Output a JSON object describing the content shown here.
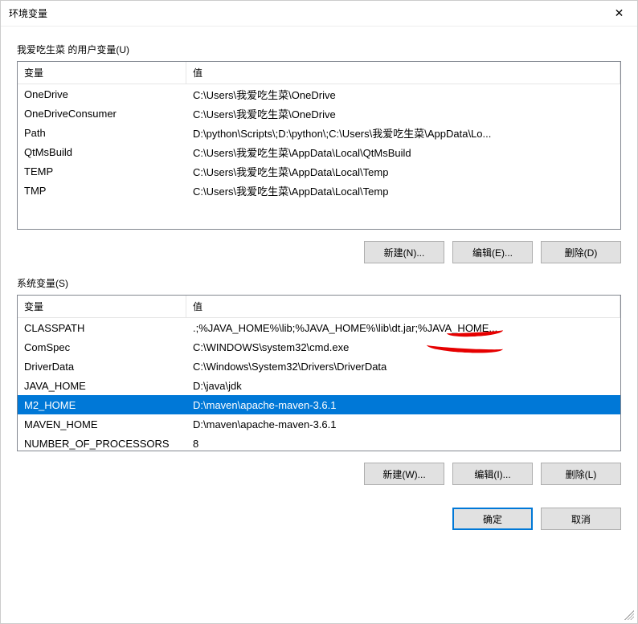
{
  "title": "环境变量",
  "user_section_label": "我爱吃生菜 的用户变量(U)",
  "system_section_label": "系统变量(S)",
  "columns": {
    "variable": "变量",
    "value": "值"
  },
  "user_vars": [
    {
      "name": "OneDrive",
      "value": "C:\\Users\\我爱吃生菜\\OneDrive"
    },
    {
      "name": "OneDriveConsumer",
      "value": "C:\\Users\\我爱吃生菜\\OneDrive"
    },
    {
      "name": "Path",
      "value": "D:\\python\\Scripts\\;D:\\python\\;C:\\Users\\我爱吃生菜\\AppData\\Lo..."
    },
    {
      "name": "QtMsBuild",
      "value": "C:\\Users\\我爱吃生菜\\AppData\\Local\\QtMsBuild"
    },
    {
      "name": "TEMP",
      "value": "C:\\Users\\我爱吃生菜\\AppData\\Local\\Temp"
    },
    {
      "name": "TMP",
      "value": "C:\\Users\\我爱吃生菜\\AppData\\Local\\Temp"
    }
  ],
  "system_vars": [
    {
      "name": "CLASSPATH",
      "value": ".;%JAVA_HOME%\\lib;%JAVA_HOME%\\lib\\dt.jar;%JAVA_HOME...",
      "selected": false
    },
    {
      "name": "ComSpec",
      "value": "C:\\WINDOWS\\system32\\cmd.exe",
      "selected": false
    },
    {
      "name": "DriverData",
      "value": "C:\\Windows\\System32\\Drivers\\DriverData",
      "selected": false
    },
    {
      "name": "JAVA_HOME",
      "value": "D:\\java\\jdk",
      "selected": false
    },
    {
      "name": "M2_HOME",
      "value": "D:\\maven\\apache-maven-3.6.1",
      "selected": true
    },
    {
      "name": "MAVEN_HOME",
      "value": "D:\\maven\\apache-maven-3.6.1",
      "selected": false
    },
    {
      "name": "NUMBER_OF_PROCESSORS",
      "value": "8",
      "selected": false
    }
  ],
  "buttons": {
    "user_new": "新建(N)...",
    "user_edit": "编辑(E)...",
    "user_delete": "删除(D)",
    "sys_new": "新建(W)...",
    "sys_edit": "编辑(I)...",
    "sys_delete": "删除(L)",
    "ok": "确定",
    "cancel": "取消"
  }
}
